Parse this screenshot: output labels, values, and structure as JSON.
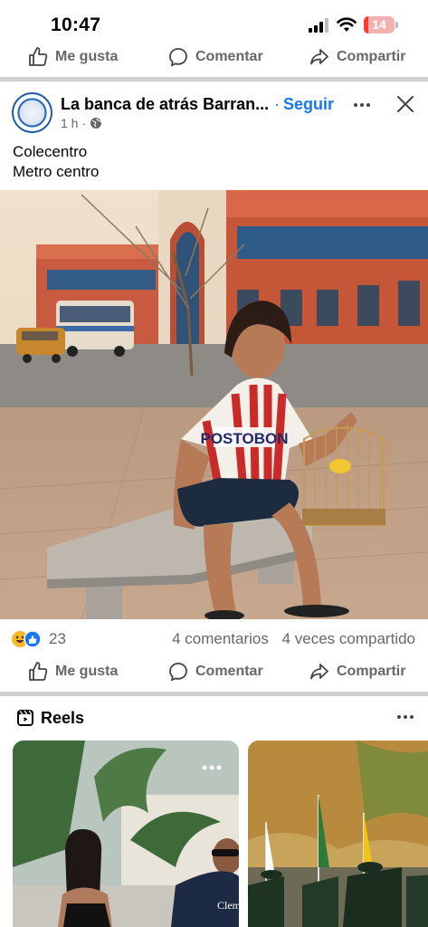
{
  "status_bar": {
    "time": "10:47",
    "battery": "14",
    "battery_level": 0.14
  },
  "top_actions": {
    "like": "Me gusta",
    "comment": "Comentar",
    "share": "Compartir"
  },
  "post": {
    "page_name": "La banca de atrás Barran...",
    "separator": "·",
    "follow": "Seguir",
    "time": "1 h",
    "meta_separator": "·",
    "text_line1": "Colecentro",
    "text_line2": "Metro centro",
    "image": {
      "jersey_text": "POSTOBON"
    },
    "reaction_count": "23",
    "comments": "4 comentarios",
    "shares": "4 veces compartido",
    "actions": {
      "like": "Me gusta",
      "comment": "Comentar",
      "share": "Compartir"
    }
  },
  "reels": {
    "title": "Reels",
    "items": [
      {
        "caption_text": "Clem"
      },
      {
        "caption_text": ""
      }
    ]
  },
  "colors": {
    "accent": "#1877f2",
    "muted": "#65676b",
    "divider": "#ced0d4",
    "battery": "#ff3b30"
  }
}
